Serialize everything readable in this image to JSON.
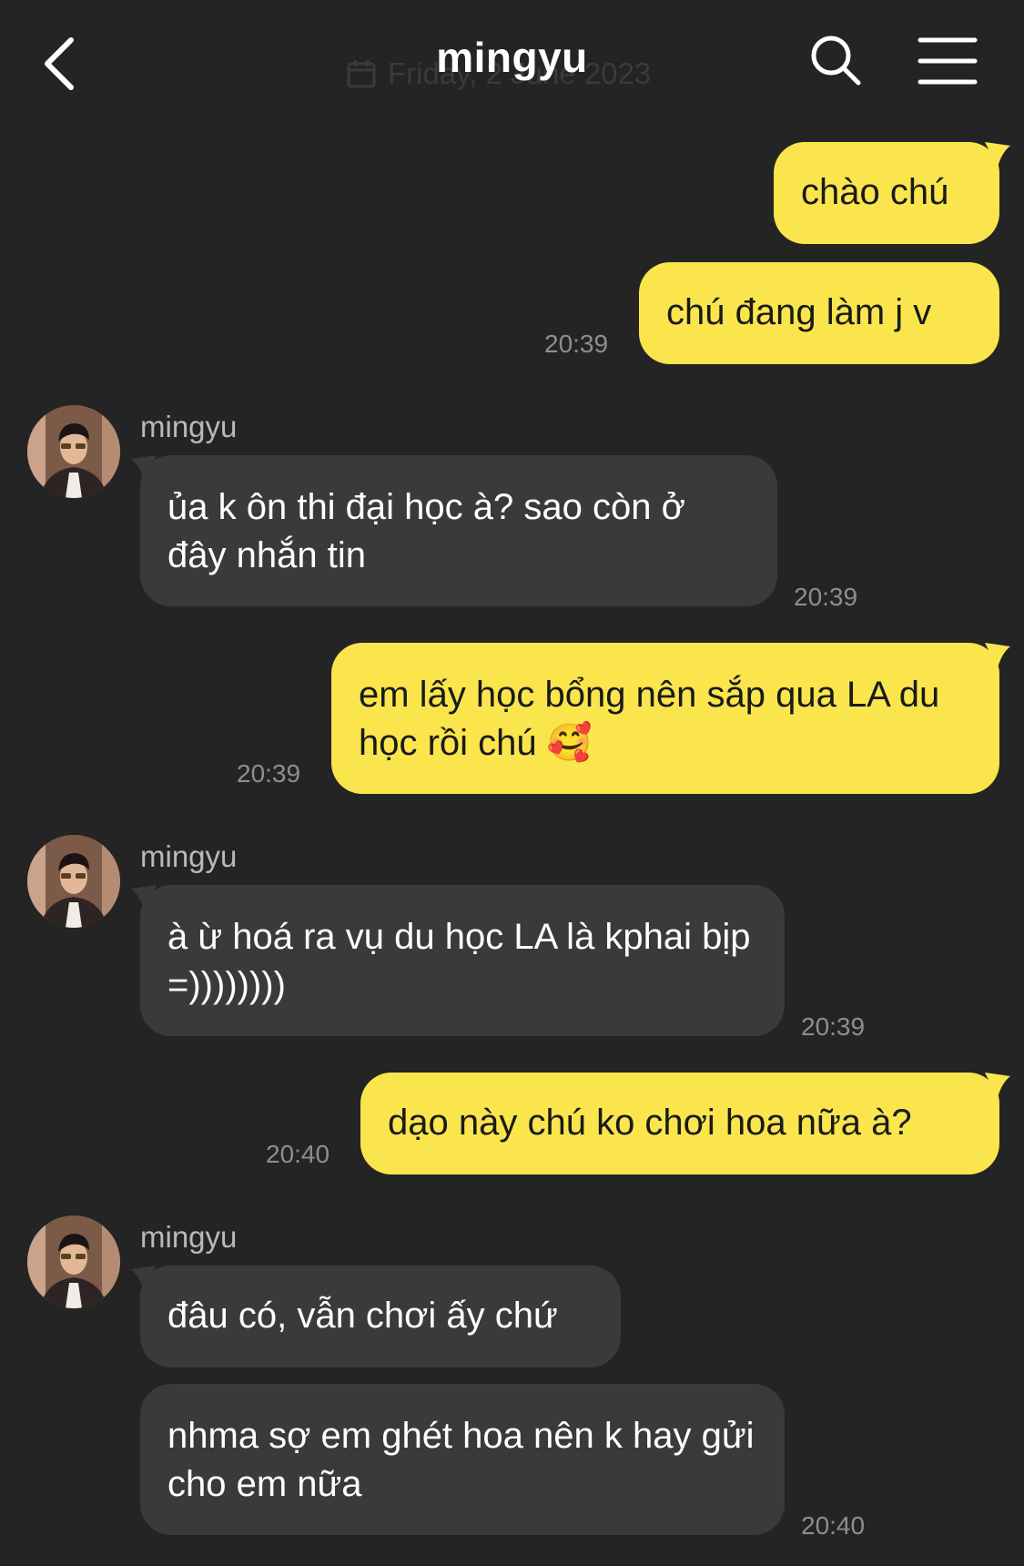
{
  "header": {
    "title": "mingyu",
    "date_ghost": "Friday, 2 June 2023",
    "back_icon": "chevron-left-icon",
    "search_icon": "search-icon",
    "menu_icon": "hamburger-menu-icon"
  },
  "colors": {
    "background": "#242424",
    "my_bubble": "#fae64c",
    "their_bubble": "#3a3a3c",
    "timestamp": "#8e8e8e"
  },
  "messages": [
    {
      "from": "me",
      "text": "chào chú"
    },
    {
      "from": "me",
      "text": "chú đang làm j v",
      "time": "20:39"
    },
    {
      "from": "mingyu",
      "sender": "mingyu",
      "text": "ủa k ôn thi đại học à? sao còn ở đây nhắn tin",
      "time": "20:39"
    },
    {
      "from": "me",
      "text": "em lấy học bổng nên sắp qua LA du học rồi chú 🥰",
      "time": "20:39"
    },
    {
      "from": "mingyu",
      "sender": "mingyu",
      "text": "à ừ hoá ra vụ du học LA là kphai bịp =))))))))",
      "time": "20:39"
    },
    {
      "from": "me",
      "text": "dạo này chú ko chơi hoa nữa à?",
      "time": "20:40"
    },
    {
      "from": "mingyu",
      "sender": "mingyu",
      "text": "đâu có, vẫn chơi ấy chứ"
    },
    {
      "from": "mingyu",
      "text": "nhma sợ em ghét hoa nên k hay gửi cho em nữa",
      "time": "20:40"
    }
  ]
}
